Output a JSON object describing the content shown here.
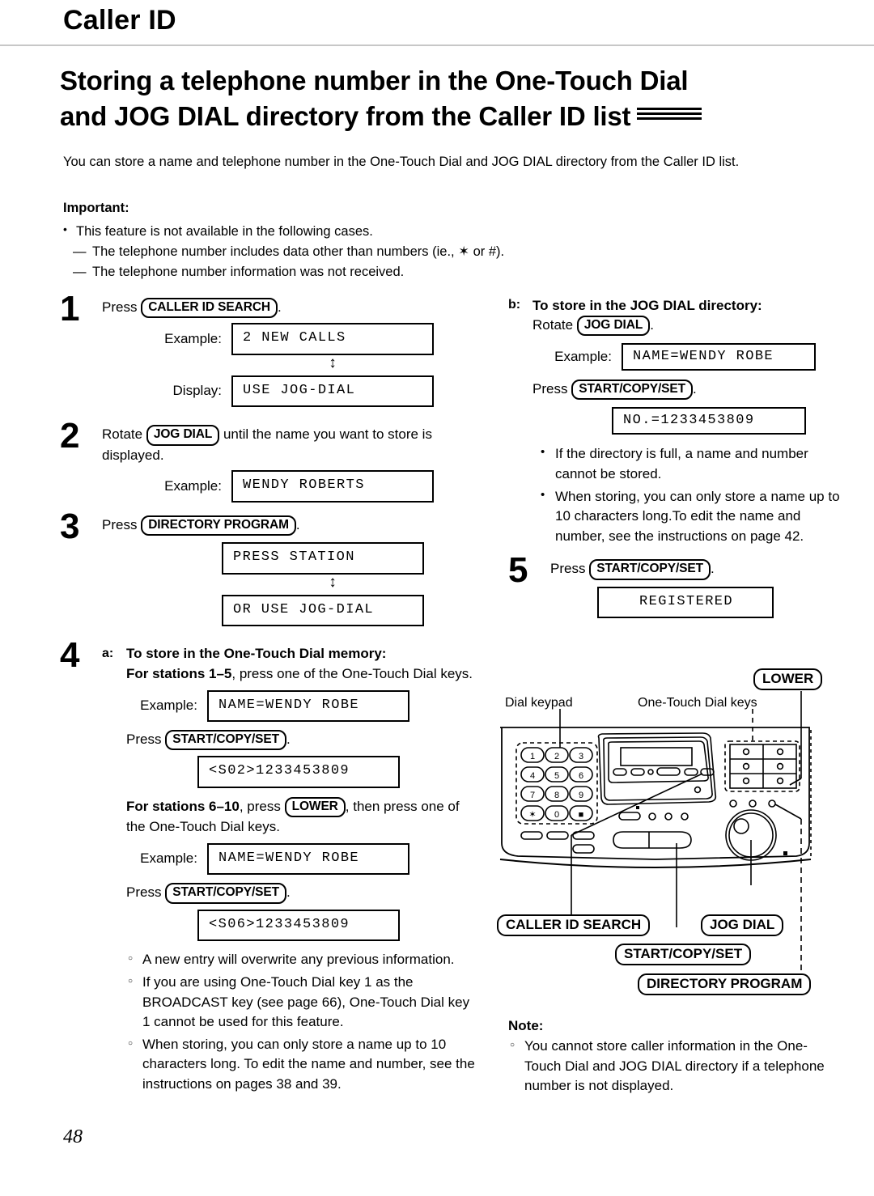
{
  "header": {
    "chapter": "Caller ID",
    "title_line1": "Storing a telephone number in the One-Touch Dial",
    "title_line2": "and JOG DIAL directory from the Caller ID list"
  },
  "intro": {
    "paragraph": "You can store a name and telephone number in the One-Touch Dial and JOG DIAL directory from the Caller ID list.",
    "important_label": "Important:",
    "bullet": "This feature is not available in the following cases.",
    "sub1": "The telephone number includes data other than numbers (ie., ✶ or #).",
    "sub2": "The telephone number information was not received."
  },
  "steps": {
    "one": {
      "num": "1",
      "press_word": "Press",
      "key": "CALLER ID SEARCH",
      "period": ".",
      "example_label": "Example:",
      "example_value": "2 NEW CALLS",
      "display_label": "Display:",
      "display_value": "USE JOG-DIAL"
    },
    "two": {
      "num": "2",
      "rotate_word": "Rotate",
      "key": "JOG DIAL",
      "text_after": "until the name you want to store is displayed.",
      "example_label": "Example:",
      "example_value": "WENDY ROBERTS"
    },
    "three": {
      "num": "3",
      "press_word": "Press",
      "key": "DIRECTORY PROGRAM",
      "period": ".",
      "display1": "PRESS STATION",
      "display2": "OR USE JOG-DIAL"
    },
    "four": {
      "num": "4",
      "a_marker": "a:",
      "a_heading": "To store in the One-Touch Dial memory:",
      "stations_bold": "For stations 1–5",
      "stations_rest": ", press one of the One-Touch Dial keys.",
      "example_label": "Example:",
      "example_value": "NAME=WENDY ROBE",
      "press_word": "Press",
      "set_key": "START/COPY/SET",
      "period": ".",
      "result1": "<S02>1233453809",
      "stations2_bold": "For stations 6–10",
      "stations2_mid": ", press",
      "lower_key": "LOWER",
      "stations2_rest": ", then press one of the One-Touch Dial keys.",
      "example2_label": "Example:",
      "example2_value": "NAME=WENDY ROBE",
      "press2_word": "Press",
      "set2_key": "START/COPY/SET",
      "result2": "<S06>1233453809",
      "bullets": [
        "A new entry will overwrite any previous information.",
        "If you are using One-Touch Dial key 1 as the BROADCAST key (see page 66), One-Touch Dial key 1 cannot be used for this feature.",
        "When storing, you can only store a name up to 10 characters long. To edit the name and number, see the instructions on pages 38 and 39."
      ]
    },
    "four_b": {
      "b_marker": "b:",
      "b_heading": "To store in the JOG DIAL directory:",
      "rotate_word": "Rotate",
      "jog_key": "JOG DIAL",
      "period": ".",
      "example_label": "Example:",
      "example_value": "NAME=WENDY ROBE",
      "press_word": "Press",
      "set_key": "START/COPY/SET",
      "result": "NO.=1233453809",
      "bullets": [
        "If the directory is full, a name and number cannot be stored.",
        "When storing, you can only store a name up to 10 characters long.To edit the name and number, see the instructions on page 42."
      ]
    },
    "five": {
      "num": "5",
      "press_word": "Press",
      "key": "START/COPY/SET",
      "period": ".",
      "result": "REGISTERED"
    }
  },
  "diagram": {
    "label_keypad": "Dial keypad",
    "label_onetouch": "One-Touch Dial keys",
    "key_lower": "LOWER",
    "key_caller_id_search": "CALLER ID SEARCH",
    "key_jog_dial": "JOG DIAL",
    "key_start_copy_set": "START/COPY/SET",
    "key_directory_program": "DIRECTORY PROGRAM",
    "keypad_keys": [
      "1",
      "2",
      "3",
      "4",
      "5",
      "6",
      "7",
      "8",
      "9",
      "✶",
      "0",
      "■"
    ]
  },
  "note": {
    "label": "Note:",
    "bullet": "You cannot store caller information in the One-Touch Dial and JOG DIAL directory if a telephone number is not displayed."
  },
  "footer": {
    "page_number": "48"
  }
}
